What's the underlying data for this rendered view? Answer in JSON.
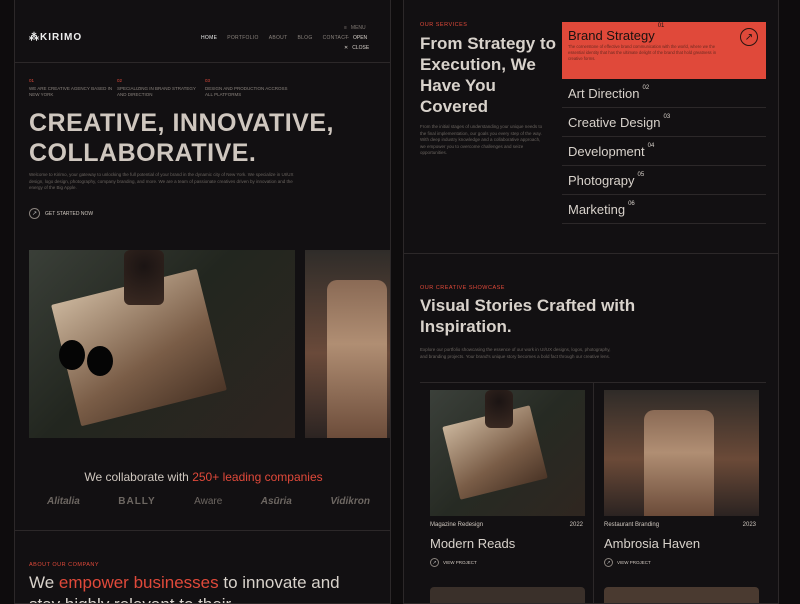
{
  "left": {
    "logo": "KIRIMO",
    "nav": [
      "HOME",
      "PORTFOLIO",
      "ABOUT",
      "BLOG",
      "CONTACT"
    ],
    "menu": {
      "menu": "MENU",
      "open": "OPEN",
      "close": "CLOSE"
    },
    "stats": [
      {
        "num": "01",
        "text": "WE ARE CREATIVE AGENCY BASED IN NEW YORK"
      },
      {
        "num": "02",
        "text": "SPECIALIZING IN BRAND STRATEGY AND DIRECTION"
      },
      {
        "num": "03",
        "text": "DESIGN AND PRODUCTION ACCROSS ALL PLATFORMS"
      }
    ],
    "hero_line1": "CREATIVE, INNOVATIVE,",
    "hero_line2": "COLLABORATIVE.",
    "hero_desc": "Welcome to Kirimo, your gateway to unlocking the full potential of your brand in the dynamic city of New York. We specialize in UI/UX design, logo design, photography, company branding, and more. We are a team of passionate creatives driven by innovation and the energy of the Big Apple.",
    "cta": "GET STARTED NOW",
    "collab_prefix": "We collaborate with ",
    "collab_highlight": "250+ leading companies",
    "partners": [
      "Alitalia",
      "BALLY",
      "Aware",
      "Asūria",
      "Vidikron"
    ],
    "about_label": "ABOUT OUR COMPANY",
    "about_prefix": "We ",
    "about_highlight": "empower businesses",
    "about_suffix": " to innovate and stay highly relevant to their"
  },
  "right": {
    "services_label": "OUR SERVICES",
    "services_title": "From Strategy to Execution, We Have You Covered",
    "services_desc": "From the initial stages of understanding your unique needs to the final implementation, our goals you every step of the way. With deep industry knowledge and a collaborative approach, we empower you to overcome challenges and seize opportunities.",
    "services": [
      {
        "name": "Brand Strategy",
        "num": "01",
        "desc": "The cornerstone of effective brand communication with the world, where we the essential identity that has the ultimate delight of the brand that hold greatness in creative forms."
      },
      {
        "name": "Art Direction",
        "num": "02"
      },
      {
        "name": "Creative Design",
        "num": "03"
      },
      {
        "name": "Development",
        "num": "04"
      },
      {
        "name": "Photograpy",
        "num": "05"
      },
      {
        "name": "Marketing",
        "num": "06"
      }
    ],
    "showcase_label": "OUR CREATIVE SHOWCASE",
    "showcase_title": "Visual Stories Crafted with Inspiration.",
    "showcase_desc": "Explore our portfolio showcasing the essence of our work in UI/UX designs, logos, photography, and branding projects. Your brand's unique story becomes a bold fact through our creative lens.",
    "projects": [
      {
        "category": "Magazine Redesign",
        "year": "2022",
        "name": "Modern Reads",
        "cta": "VIEW PROJECT"
      },
      {
        "category": "Restaurant Branding",
        "year": "2023",
        "name": "Ambrosia Haven",
        "cta": "VIEW PROJECT"
      }
    ]
  },
  "colors": {
    "accent": "#e0493a",
    "bg": "#121012"
  },
  "icons": {
    "arrow": "arrow-up-right-icon",
    "menu": "menu-icon",
    "close": "close-icon"
  }
}
